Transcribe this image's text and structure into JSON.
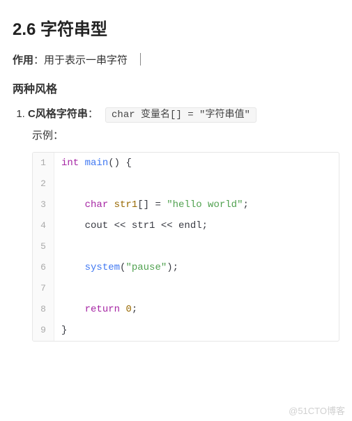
{
  "section": {
    "number": "2.6",
    "title": "字符串型"
  },
  "intro": {
    "label": "作用",
    "colon": "：",
    "text": "用于表示一串字符"
  },
  "styles_heading": "两种风格",
  "list_item": {
    "title": "C风格字符串",
    "colon": "：",
    "code": "char 变量名[] = \"字符串值\"",
    "example_label": "示例："
  },
  "code": {
    "lines": [
      {
        "n": "1",
        "tokens": [
          {
            "cls": "tok-kw",
            "t": "int"
          },
          {
            "cls": "tok-plain",
            "t": " "
          },
          {
            "cls": "tok-func",
            "t": "main"
          },
          {
            "cls": "tok-plain",
            "t": "() {"
          }
        ]
      },
      {
        "n": "2",
        "tokens": []
      },
      {
        "n": "3",
        "tokens": [
          {
            "cls": "tok-plain",
            "t": "    "
          },
          {
            "cls": "tok-kw",
            "t": "char"
          },
          {
            "cls": "tok-plain",
            "t": " "
          },
          {
            "cls": "tok-var",
            "t": "str1"
          },
          {
            "cls": "tok-plain",
            "t": "[] = "
          },
          {
            "cls": "tok-str",
            "t": "\"hello world\""
          },
          {
            "cls": "tok-plain",
            "t": ";"
          }
        ]
      },
      {
        "n": "4",
        "tokens": [
          {
            "cls": "tok-plain",
            "t": "    cout << str1 << endl;"
          }
        ]
      },
      {
        "n": "5",
        "tokens": []
      },
      {
        "n": "6",
        "tokens": [
          {
            "cls": "tok-plain",
            "t": "    "
          },
          {
            "cls": "tok-func",
            "t": "system"
          },
          {
            "cls": "tok-plain",
            "t": "("
          },
          {
            "cls": "tok-str",
            "t": "\"pause\""
          },
          {
            "cls": "tok-plain",
            "t": ");"
          }
        ]
      },
      {
        "n": "7",
        "tokens": []
      },
      {
        "n": "8",
        "tokens": [
          {
            "cls": "tok-plain",
            "t": "    "
          },
          {
            "cls": "tok-kw",
            "t": "return"
          },
          {
            "cls": "tok-plain",
            "t": " "
          },
          {
            "cls": "tok-num",
            "t": "0"
          },
          {
            "cls": "tok-plain",
            "t": ";"
          }
        ]
      },
      {
        "n": "9",
        "tokens": [
          {
            "cls": "tok-plain",
            "t": "}"
          }
        ]
      }
    ]
  },
  "watermark": "@51CTO博客"
}
